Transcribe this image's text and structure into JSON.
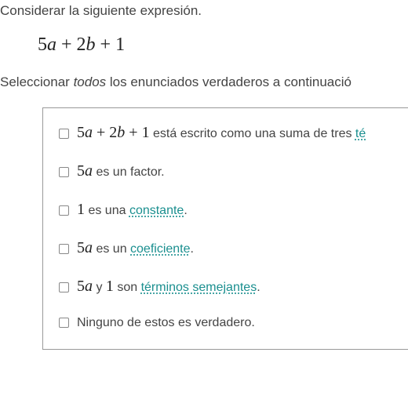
{
  "intro": "Considerar la siguiente expresión.",
  "expression": {
    "parts": [
      "5",
      "a",
      " + ",
      "2",
      "b",
      " + ",
      "1"
    ]
  },
  "prompt_pre": "Seleccionar ",
  "prompt_em": "todos",
  "prompt_post": " los enunciados verdaderos a continuació",
  "options": [
    {
      "math_parts": [
        "5",
        "a",
        " + ",
        "2",
        "b",
        " + ",
        "1"
      ],
      "text_pre": " está escrito como una suma de tres ",
      "link": "té",
      "text_post": ""
    },
    {
      "math_parts": [
        "5",
        "a"
      ],
      "text_pre": " es un factor.",
      "link": "",
      "text_post": ""
    },
    {
      "math_parts": [
        "1"
      ],
      "text_pre": " es una ",
      "link": "constante",
      "text_post": "."
    },
    {
      "math_parts": [
        "5",
        "a"
      ],
      "text_pre": " es un ",
      "link": "coeficiente",
      "text_post": "."
    },
    {
      "math_parts_a": [
        "5",
        "a"
      ],
      "between": " y ",
      "math_parts_b": [
        "1"
      ],
      "text_pre": " son ",
      "link": "términos semejantes",
      "text_post": "."
    },
    {
      "math_parts": [],
      "text_pre": "Ninguno de estos es verdadero.",
      "link": "",
      "text_post": ""
    }
  ]
}
